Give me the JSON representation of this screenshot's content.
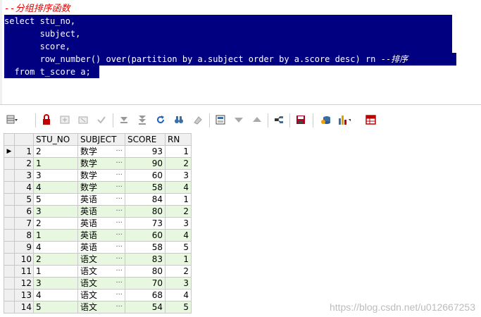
{
  "editor": {
    "comment": "--分组排序函数",
    "lines": [
      "select stu_no,",
      "       subject,",
      "       score,",
      "       row_number() over(partition by a.subject order by a.score desc) rn --",
      "  from t_score a;"
    ],
    "line4_comment": "排序"
  },
  "toolbar": {
    "icons": [
      "grid-menu-icon",
      "lock-icon",
      "add-record-icon",
      "delete-record-icon",
      "post-icon",
      "next-record-icon",
      "last-record-icon",
      "refresh-icon",
      "find-icon",
      "clear-icon",
      "query-by-example-icon",
      "filter-icon",
      "sort-icon",
      "export-icon",
      "save-icon",
      "import-icon",
      "chart-icon",
      "table-view-icon"
    ],
    "accent_colors": {
      "lock": "#c00000",
      "save": "#b00020",
      "table": "#c00000"
    }
  },
  "grid": {
    "columns": [
      "STU_NO",
      "SUBJECT",
      "SCORE",
      "RN"
    ],
    "rows": [
      {
        "no": "1",
        "stu_no": "2",
        "subject": "数学",
        "score": "93",
        "rn": "1"
      },
      {
        "no": "2",
        "stu_no": "1",
        "subject": "数学",
        "score": "90",
        "rn": "2"
      },
      {
        "no": "3",
        "stu_no": "3",
        "subject": "数学",
        "score": "60",
        "rn": "3"
      },
      {
        "no": "4",
        "stu_no": "4",
        "subject": "数学",
        "score": "58",
        "rn": "4"
      },
      {
        "no": "5",
        "stu_no": "5",
        "subject": "英语",
        "score": "84",
        "rn": "1"
      },
      {
        "no": "6",
        "stu_no": "3",
        "subject": "英语",
        "score": "80",
        "rn": "2"
      },
      {
        "no": "7",
        "stu_no": "2",
        "subject": "英语",
        "score": "73",
        "rn": "3"
      },
      {
        "no": "8",
        "stu_no": "1",
        "subject": "英语",
        "score": "60",
        "rn": "4"
      },
      {
        "no": "9",
        "stu_no": "4",
        "subject": "英语",
        "score": "58",
        "rn": "5"
      },
      {
        "no": "10",
        "stu_no": "2",
        "subject": "语文",
        "score": "83",
        "rn": "1"
      },
      {
        "no": "11",
        "stu_no": "1",
        "subject": "语文",
        "score": "80",
        "rn": "2"
      },
      {
        "no": "12",
        "stu_no": "3",
        "subject": "语文",
        "score": "70",
        "rn": "3"
      },
      {
        "no": "13",
        "stu_no": "4",
        "subject": "语文",
        "score": "68",
        "rn": "4"
      },
      {
        "no": "14",
        "stu_no": "5",
        "subject": "语文",
        "score": "54",
        "rn": "5"
      }
    ],
    "current_row_marker": "▶",
    "ellipsis": "···",
    "row_colors": {
      "odd": "#ffffff",
      "even": "#e8f8e0"
    }
  },
  "watermark": "https://blog.csdn.net/u012667253"
}
